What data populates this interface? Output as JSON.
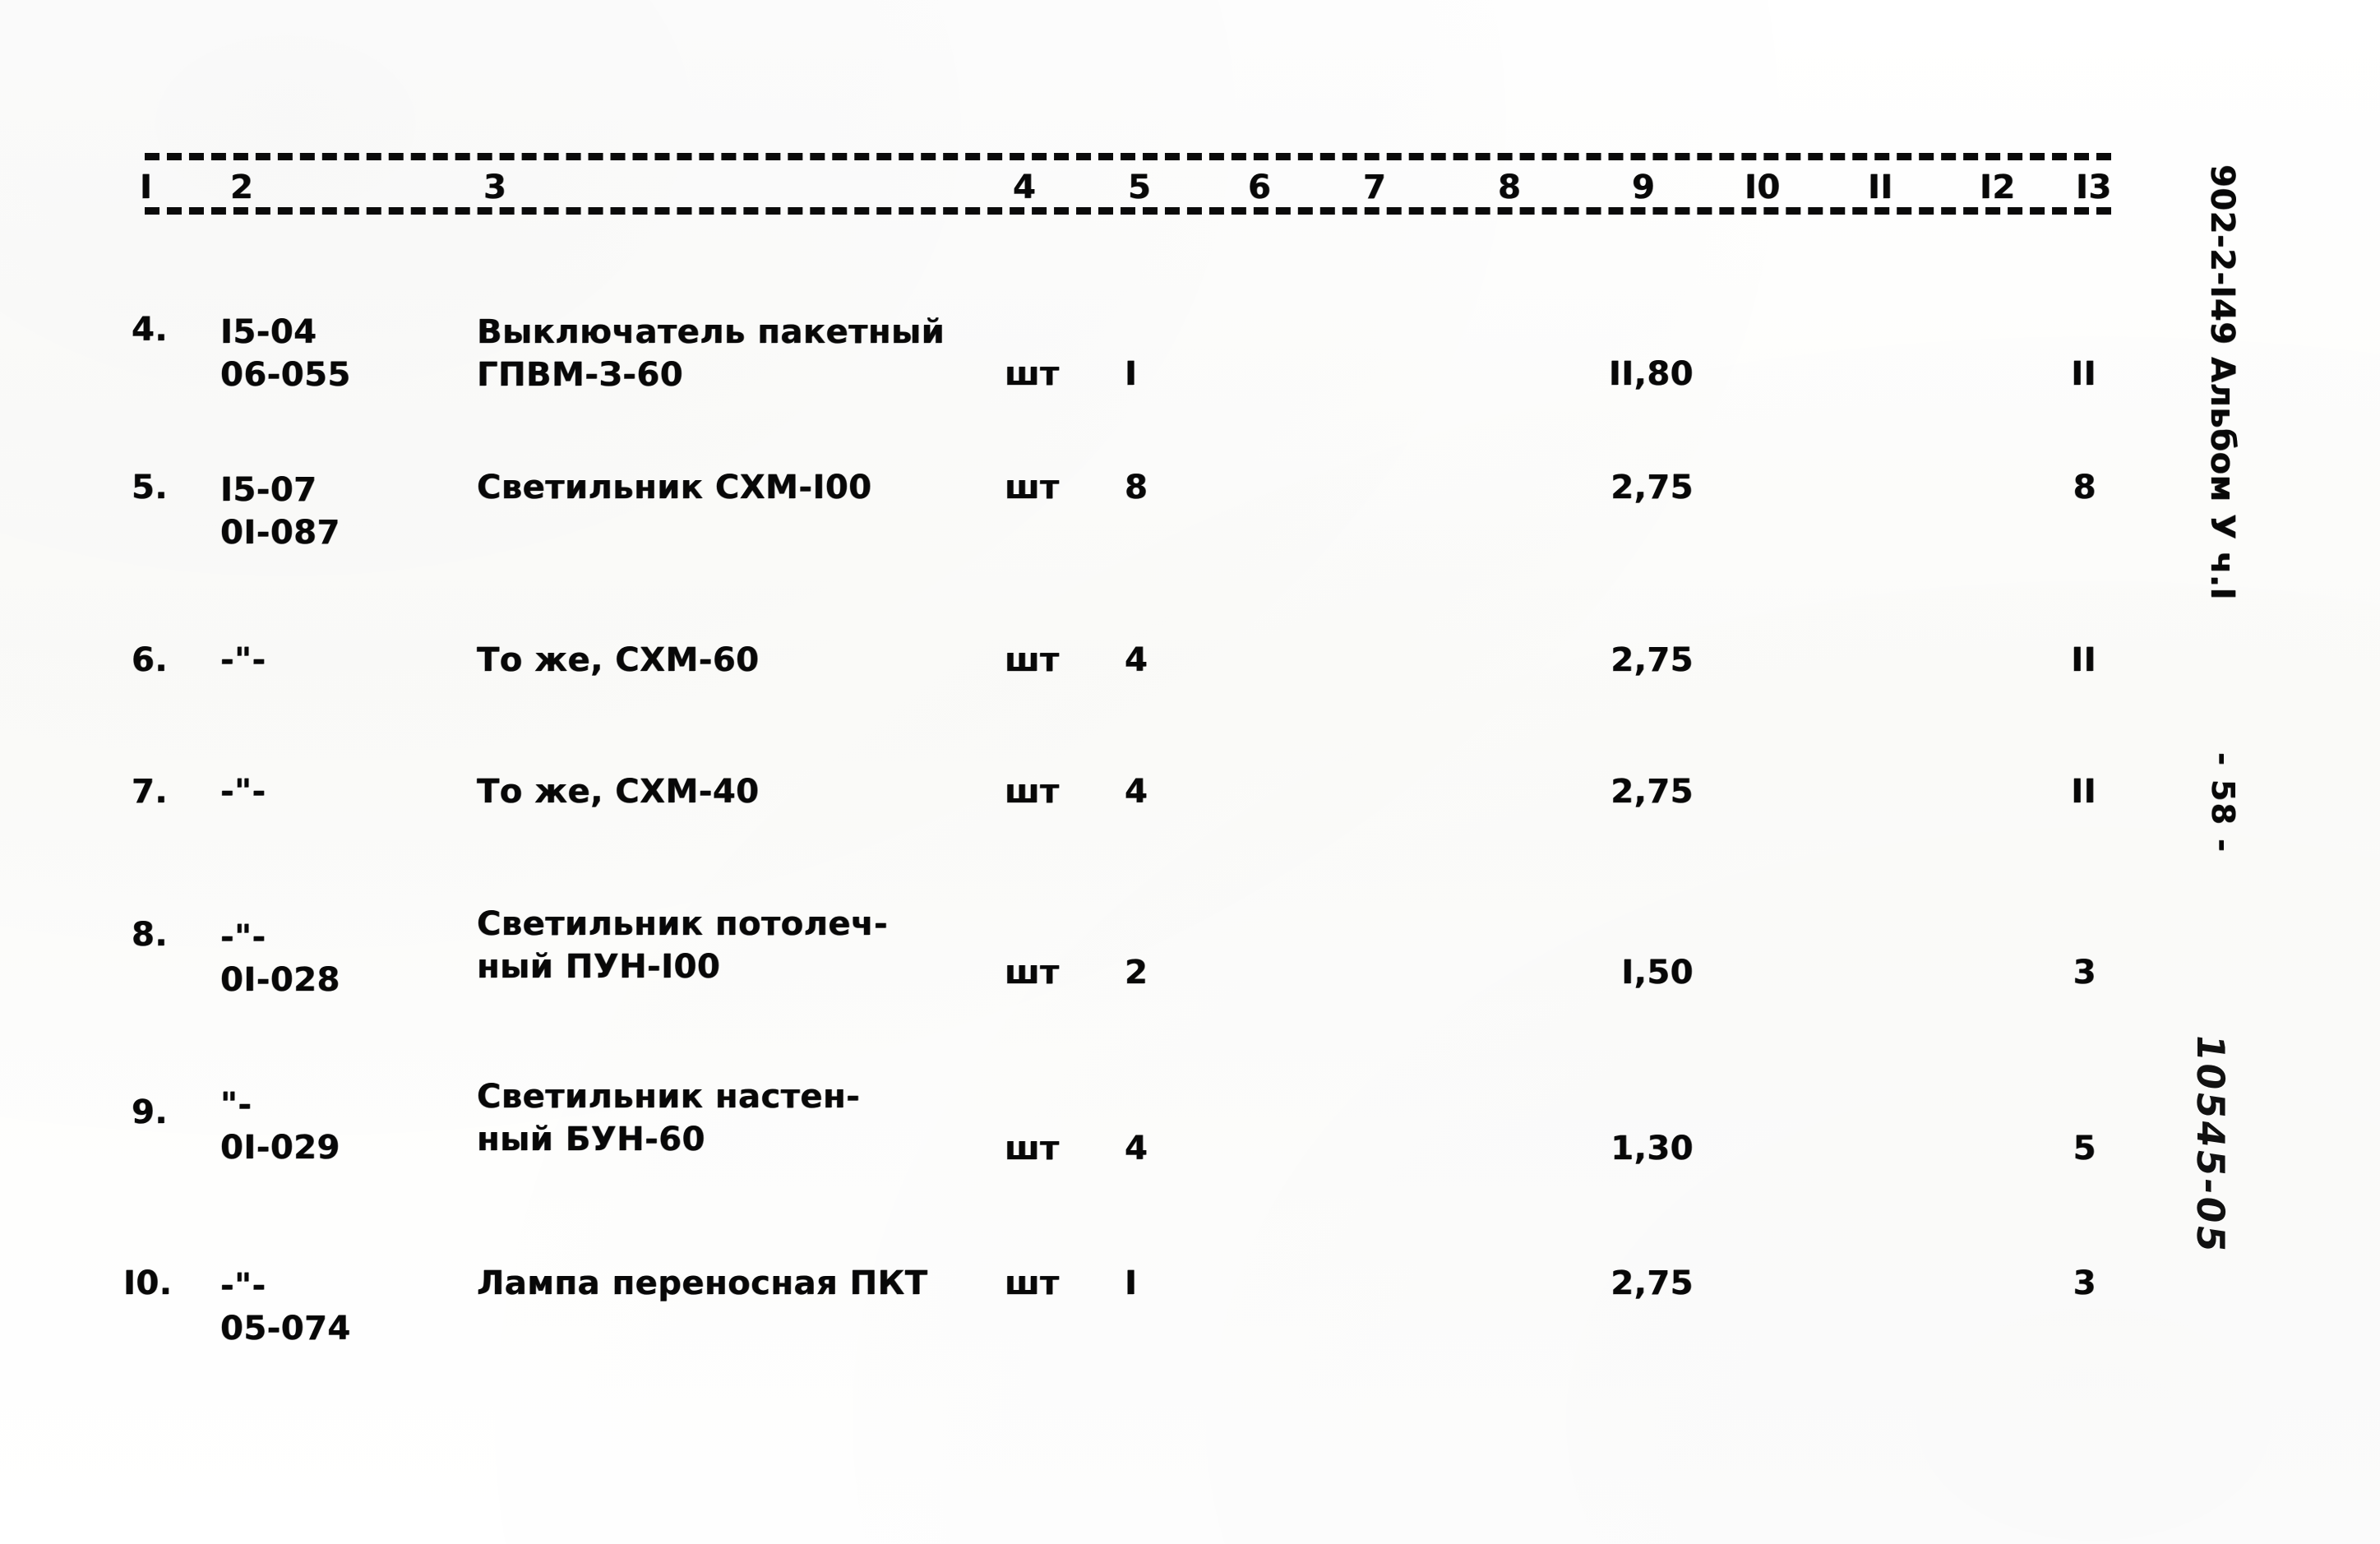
{
  "document": {
    "reference": "902-2-I49 Альбом У ч.I",
    "page_marker": "- 58 -",
    "handwritten_stamp": "10545-05"
  },
  "table": {
    "column_headers": [
      "I",
      "2",
      "3",
      "4",
      "5",
      "6",
      "7",
      "8",
      "9",
      "I0",
      "II",
      "I2",
      "I3"
    ],
    "rows": [
      {
        "num": "4.",
        "code": "I5-04\n06-055",
        "description": "Выключатель пакетный\nГПВМ-З-60",
        "unit": "шт",
        "qty": "I",
        "price": "II,80",
        "last": "II"
      },
      {
        "num": "5.",
        "code": "I5-07\n0I-087",
        "description": "Светильник СХМ-I00",
        "unit": "шт",
        "qty": "8",
        "price": "2,75",
        "last": "8"
      },
      {
        "num": "6.",
        "code": "-\"-",
        "description": "То же, СХМ-60",
        "unit": "шт",
        "qty": "4",
        "price": "2,75",
        "last": "II"
      },
      {
        "num": "7.",
        "code": "-\"-",
        "description": "То же, СХМ-40",
        "unit": "шт",
        "qty": "4",
        "price": "2,75",
        "last": "II"
      },
      {
        "num": "8.",
        "code": "-\"-\n0I-028",
        "description": "Светильник потолеч-\nный ПУН-I00",
        "unit": "шт",
        "qty": "2",
        "price": "I,50",
        "last": "3"
      },
      {
        "num": "9.",
        "code": "\"-\n0I-029",
        "description": "Светильник настен-\nный БУН-60",
        "unit": "шт",
        "qty": "4",
        "price": "1,30",
        "last": "5"
      },
      {
        "num": "I0.",
        "code": "-\"-\n05-074",
        "description": "Лампа переносная ПКТ",
        "unit": "шт",
        "qty": "I",
        "price": "2,75",
        "last": "3"
      }
    ]
  }
}
